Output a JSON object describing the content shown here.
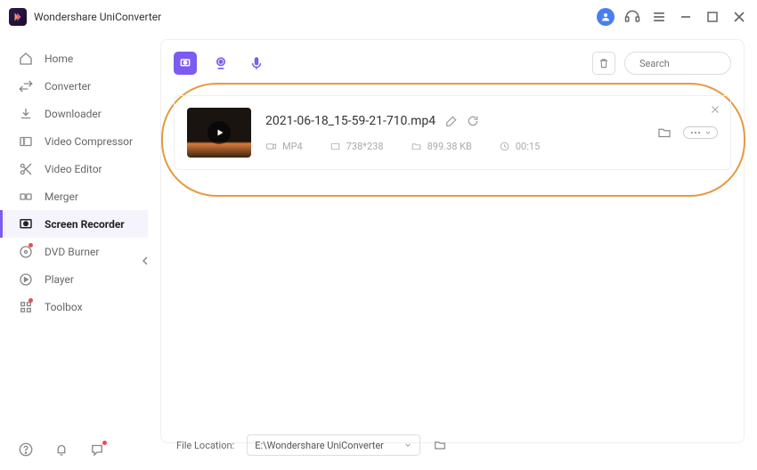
{
  "app": {
    "title": "Wondershare UniConverter"
  },
  "sidebar": {
    "items": [
      {
        "label": "Home"
      },
      {
        "label": "Converter"
      },
      {
        "label": "Downloader"
      },
      {
        "label": "Video Compressor"
      },
      {
        "label": "Video Editor"
      },
      {
        "label": "Merger"
      },
      {
        "label": "Screen Recorder"
      },
      {
        "label": "DVD Burner"
      },
      {
        "label": "Player"
      },
      {
        "label": "Toolbox"
      }
    ]
  },
  "search": {
    "placeholder": "Search"
  },
  "file": {
    "name": "2021-06-18_15-59-21-710.mp4",
    "format": "MP4",
    "resolution": "738*238",
    "size": "899.38 KB",
    "duration": "00:15"
  },
  "footer": {
    "label": "File Location:",
    "path": "E:\\Wondershare UniConverter"
  }
}
